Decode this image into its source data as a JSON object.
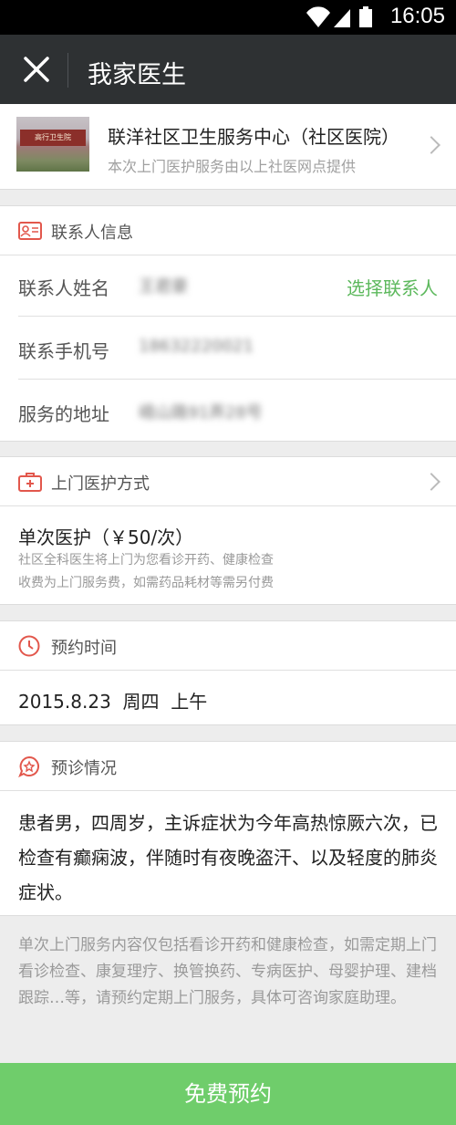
{
  "status_bar": {
    "time": "16:05"
  },
  "title_bar": {
    "title": "我家医生"
  },
  "hospital": {
    "name": "联洋社区卫生服务中心（社区医院）",
    "description": "本次上门医护服务由以上社医网点提供",
    "image_sign_text": "高行卫生院"
  },
  "contact": {
    "section_label": "联系人信息",
    "name_label": "联系人姓名",
    "name_value": "王君豪",
    "choose_contact": "选择联系人",
    "phone_label": "联系手机号",
    "phone_value": "18632220021",
    "address_label": "服务的地址",
    "address_value": "峨山路91弄28号"
  },
  "service": {
    "section_label": "上门医护方式",
    "option_title": "单次医护（￥50/次）",
    "option_desc_1": "社区全科医生将上门为您看诊开药、健康检查",
    "option_desc_2": "收费为上门服务费，如需药品耗材等需另付费"
  },
  "appointment": {
    "section_label": "预约时间",
    "value": "2015.8.23  周四  上午"
  },
  "diagnosis": {
    "section_label": "预诊情况",
    "text": "患者男，四周岁，主诉症状为今年高热惊厥六次，已检查有癫痫波，伴随时有夜晚盗汗、以及轻度的肺炎症状。"
  },
  "notes": "单次上门服务内容仅包括看诊开药和健康检查，如需定期上门看诊检查、康复理疗、换管换药、专病医护、母婴护理、建档跟踪…等，请预约定期上门服务，具体可咨询家庭助理。",
  "submit_button": "免费预约",
  "colors": {
    "accent_green": "#6fcd6b",
    "link_green": "#5cb85c",
    "icon_red": "#e2574c",
    "title_bar": "#2e3133"
  }
}
